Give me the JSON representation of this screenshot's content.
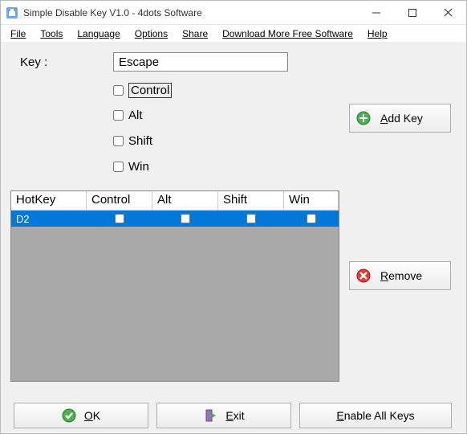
{
  "window": {
    "title": "Simple Disable Key V1.0 - 4dots Software"
  },
  "menu": {
    "file": "File",
    "tools": "Tools",
    "language": "Language",
    "options": "Options",
    "share": "Share",
    "download": "Download More Free Software",
    "help": "Help"
  },
  "form": {
    "key_label": "Key :",
    "key_value": "Escape",
    "control_label": "Control",
    "alt_label": "Alt",
    "shift_label": "Shift",
    "win_label": "Win",
    "control_checked": false,
    "alt_checked": false,
    "shift_checked": false,
    "win_checked": false
  },
  "buttons": {
    "add_key": "Add Key",
    "remove": "Remove",
    "ok": "OK",
    "exit": "Exit",
    "enable_all": "Enable All Keys"
  },
  "grid": {
    "columns": {
      "hotkey": "HotKey",
      "control": "Control",
      "alt": "Alt",
      "shift": "Shift",
      "win": "Win"
    },
    "rows": [
      {
        "hotkey": "D2",
        "control": false,
        "alt": false,
        "shift": false,
        "win": false,
        "selected": true
      }
    ]
  }
}
